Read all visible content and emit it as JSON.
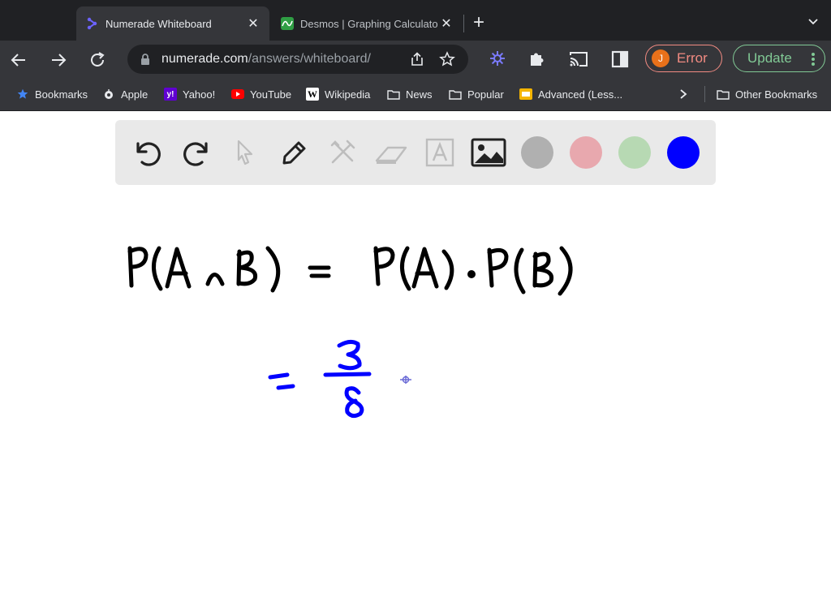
{
  "browser": {
    "tabs": [
      {
        "title": "Numerade Whiteboard",
        "active": true,
        "icon": "numerade-logo-icon"
      },
      {
        "title": "Desmos | Graphing Calculator",
        "active": false,
        "icon": "desmos-logo-icon"
      }
    ],
    "address": {
      "domain": "numerade.com",
      "path": "/answers/whiteboard/"
    },
    "profile": {
      "initial": "J",
      "status": "Error"
    },
    "update_label": "Update",
    "bookmarks": [
      "Bookmarks",
      "Apple",
      "Yahoo!",
      "YouTube",
      "Wikipedia",
      "News",
      "Popular",
      "Advanced (Less...",
      "Other Bookmarks"
    ]
  },
  "whiteboard": {
    "tools": [
      "undo",
      "redo",
      "select",
      "pen",
      "tools",
      "eraser",
      "text",
      "image"
    ],
    "colors": [
      "#b0b0b0",
      "#e8a8ae",
      "#b7d9b3",
      "#0000ff"
    ],
    "handwriting": {
      "line1": "P(A ∩ B) = P(A) · P(B)",
      "line2": "= 3/8"
    }
  }
}
